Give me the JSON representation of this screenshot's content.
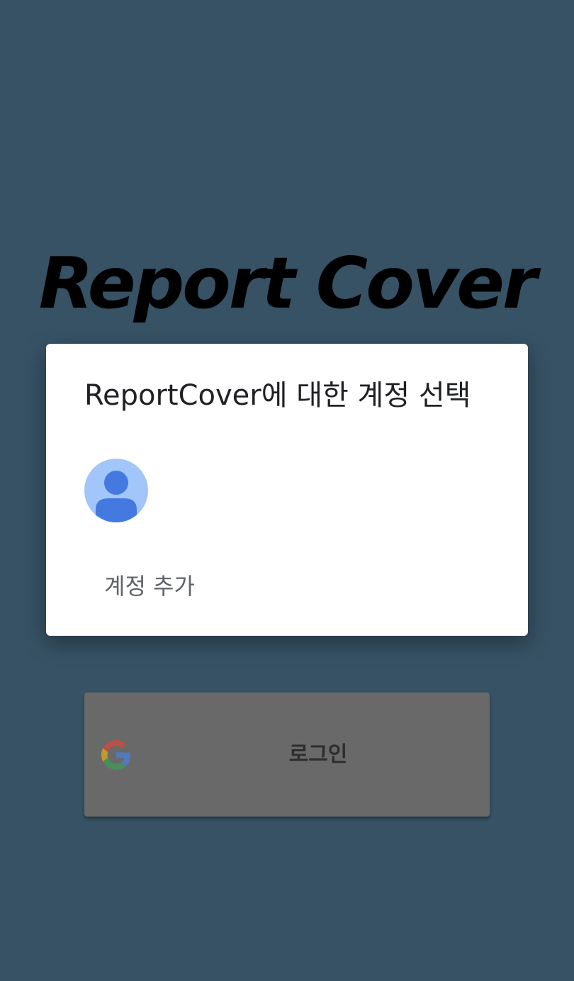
{
  "app": {
    "title": "Report Cover"
  },
  "login": {
    "label": "로그인",
    "icon": "google-icon"
  },
  "account_dialog": {
    "title": "ReportCover에 대한 계정 선택",
    "account_avatar_icon": "avatar-icon",
    "add_account_label": "계정 추가"
  },
  "colors": {
    "background": "#365264",
    "dialog": "#ffffff",
    "login_button": "#696969",
    "avatar_bg": "#a2c5fa",
    "avatar_fg": "#4479e0"
  }
}
